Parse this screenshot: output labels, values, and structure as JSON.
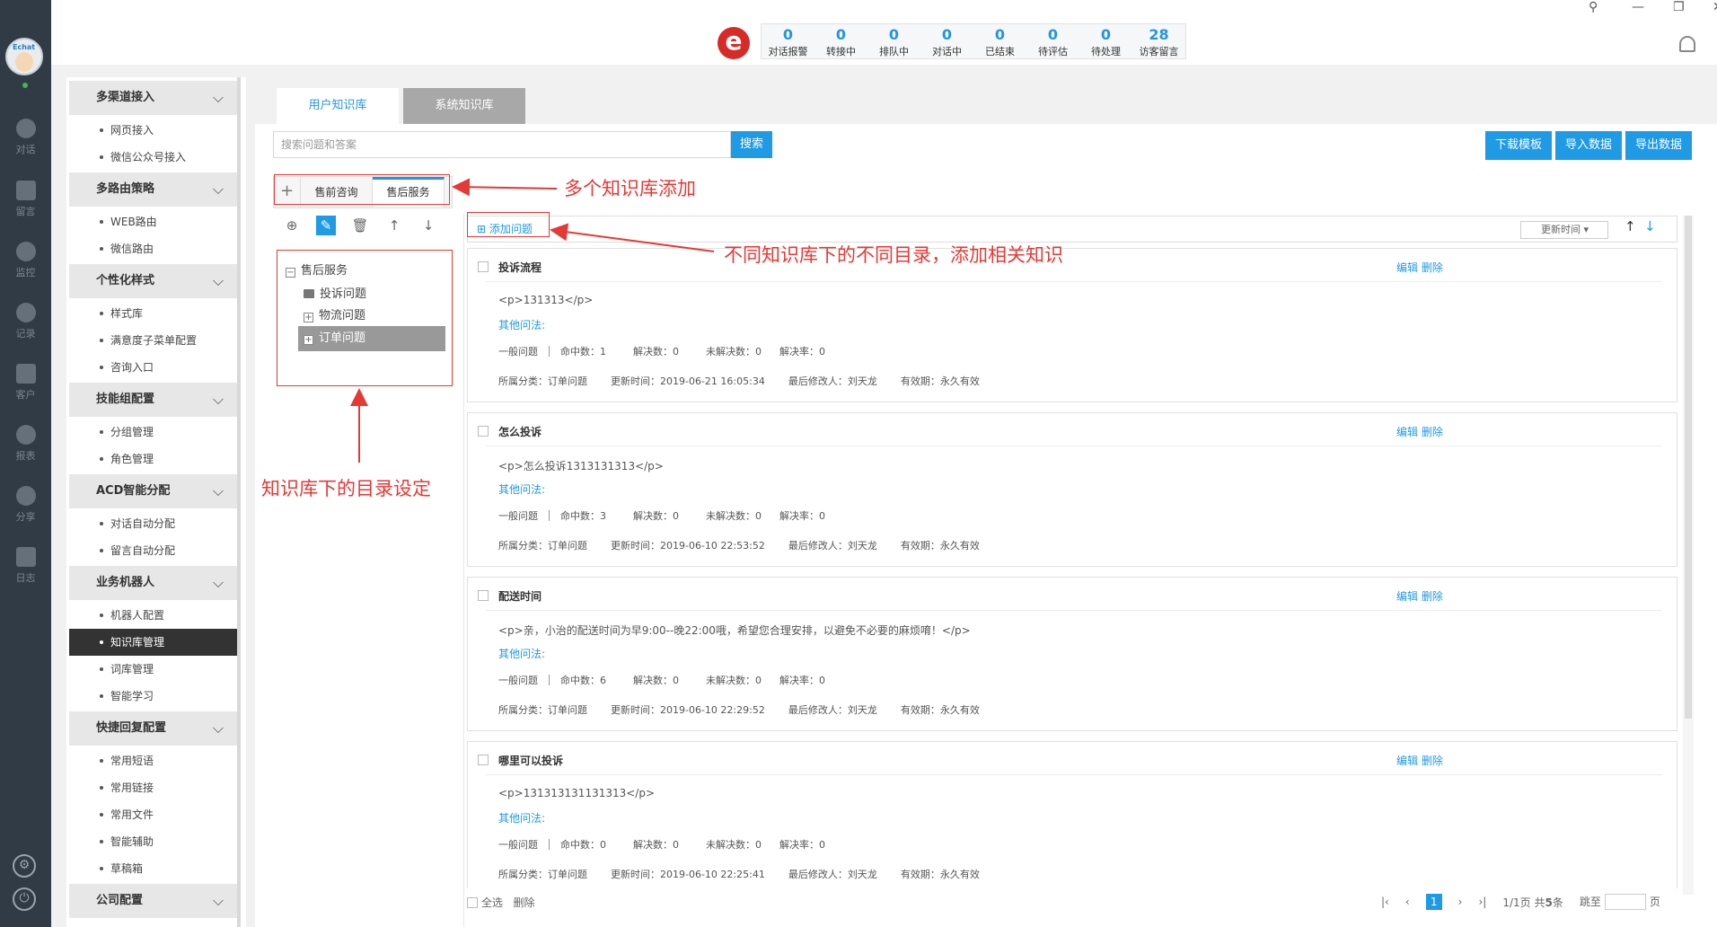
{
  "stats": [
    {
      "value": "0",
      "label": "对话报警"
    },
    {
      "value": "0",
      "label": "转接中"
    },
    {
      "value": "0",
      "label": "排队中"
    },
    {
      "value": "0",
      "label": "对话中"
    },
    {
      "value": "0",
      "label": "已结束"
    },
    {
      "value": "0",
      "label": "待评估"
    },
    {
      "value": "0",
      "label": "待处理"
    },
    {
      "value": "28",
      "label": "访客留言"
    }
  ],
  "logo_letter": "e",
  "avatar_brand": "Echat",
  "rail": [
    "对话",
    "留言",
    "监控",
    "记录",
    "客户",
    "报表",
    "分享",
    "日志"
  ],
  "nav": {
    "groups": [
      {
        "label": "多渠道接入",
        "items": [
          "网页接入",
          "微信公众号接入"
        ]
      },
      {
        "label": "多路由策略",
        "items": [
          "WEB路由",
          "微信路由"
        ]
      },
      {
        "label": "个性化样式",
        "items": [
          "样式库",
          "满意度子菜单配置",
          "咨询入口"
        ]
      },
      {
        "label": "技能组配置",
        "items": [
          "分组管理",
          "角色管理"
        ]
      },
      {
        "label": "ACD智能分配",
        "items": [
          "对话自动分配",
          "留言自动分配"
        ]
      },
      {
        "label": "业务机器人",
        "items": [
          "机器人配置",
          "知识库管理",
          "词库管理",
          "智能学习"
        ]
      },
      {
        "label": "快捷回复配置",
        "items": [
          "常用短语",
          "常用链接",
          "常用文件",
          "智能辅助",
          "草稿箱"
        ]
      },
      {
        "label": "公司配置",
        "items": []
      }
    ]
  },
  "tabs": {
    "user": "用户知识库",
    "system": "系统知识库"
  },
  "search": {
    "placeholder": "搜索问题和答案",
    "button": "搜索"
  },
  "toolbar": {
    "download": "下载模板",
    "import": "导入数据",
    "export": "导出数据"
  },
  "libraries": {
    "tab1": "售前咨询",
    "tab2": "售后服务"
  },
  "tree": {
    "root": "售后服务",
    "children": [
      "投诉问题",
      "物流问题",
      "订单问题"
    ]
  },
  "list": {
    "add": "添加问题",
    "sort": "更新时间"
  },
  "cards": [
    {
      "title": "投诉流程",
      "body": "<p>131313</p>",
      "hits": "命中数：1",
      "updated": "更新时间：2019-06-21 16:05:34"
    },
    {
      "title": "怎么投诉",
      "body": "<p>怎么投诉1313131313</p>",
      "hits": "命中数：3",
      "updated": "更新时间：2019-06-10 22:53:52"
    },
    {
      "title": "配送时间",
      "body": "<p>亲，小治的配送时间为早9:00--晚22:00哦，希望您合理安排，以避免不必要的麻烦唷！</p>",
      "hits": "命中数：6",
      "updated": "更新时间：2019-06-10 22:29:52"
    },
    {
      "title": "哪里可以投诉",
      "body": "<p>131313131131313</p>",
      "hits": "命中数：0",
      "updated": "更新时间：2019-06-10 22:25:41"
    }
  ],
  "card_common": {
    "edit": "编辑",
    "delete": "删除",
    "other": "其他问法:",
    "type": "一般问题",
    "solved": "解决数：0",
    "unsolved": "未解决数：0",
    "rate": "解决率：0",
    "category": "所属分类：订单问题",
    "modifier": "最后修改人：刘天龙",
    "validity": "有效期：永久有效"
  },
  "footer": {
    "select_all": "全选",
    "delete": "删除",
    "page": "1",
    "pages": "1/1页",
    "total_prefix": "共",
    "total_num": "5",
    "total_suffix": "条",
    "jump": "跳至",
    "unit": "页"
  },
  "annotations": {
    "a1": "多个知识库添加",
    "a2": "不同知识库下的不同目录，添加相关知识",
    "a3": "知识库下的目录设定"
  }
}
